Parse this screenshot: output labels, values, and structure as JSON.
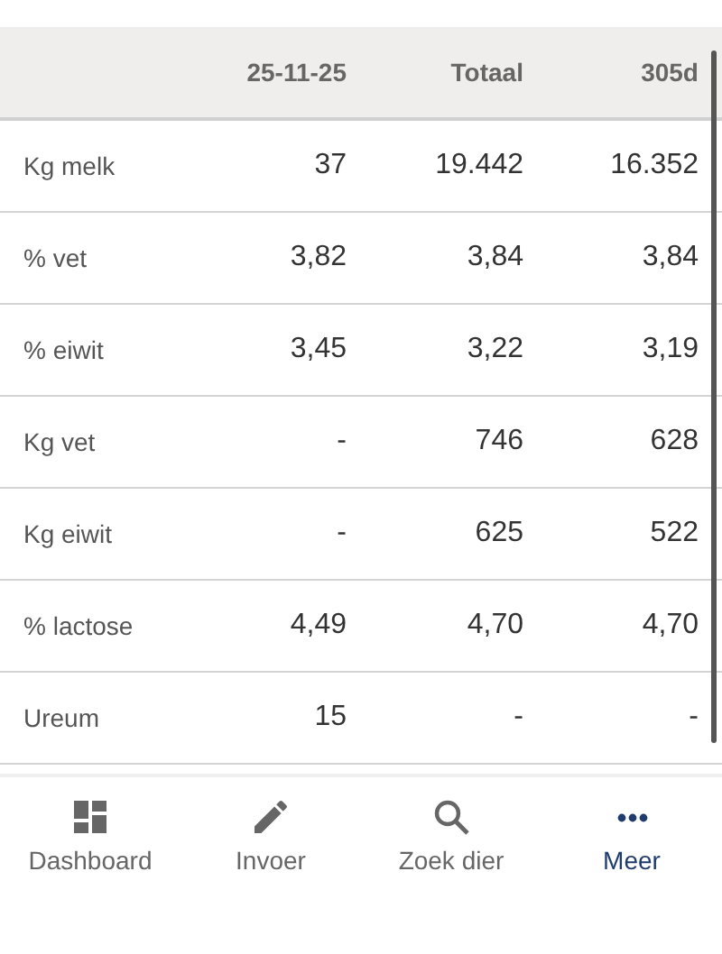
{
  "table": {
    "columns": [
      "",
      "25-11-25",
      "Totaal",
      "305d"
    ],
    "rows": [
      {
        "label": "Kg melk",
        "values": [
          "37",
          "19.442",
          "16.352"
        ]
      },
      {
        "label": "% vet",
        "values": [
          "3,82",
          "3,84",
          "3,84"
        ]
      },
      {
        "label": "% eiwit",
        "values": [
          "3,45",
          "3,22",
          "3,19"
        ]
      },
      {
        "label": "Kg vet",
        "values": [
          "-",
          "746",
          "628"
        ]
      },
      {
        "label": "Kg eiwit",
        "values": [
          "-",
          "625",
          "522"
        ]
      },
      {
        "label": "% lactose",
        "values": [
          "4,49",
          "4,70",
          "4,70"
        ]
      },
      {
        "label": "Ureum",
        "values": [
          "15",
          "-",
          "-"
        ]
      }
    ]
  },
  "bottom_nav": [
    {
      "label": "Dashboard",
      "kind": "dashboard",
      "selected": false
    },
    {
      "label": "Invoer",
      "kind": "pencil",
      "selected": false
    },
    {
      "label": "Zoek dier",
      "kind": "search",
      "selected": false
    },
    {
      "label": "Meer",
      "kind": "more",
      "selected": true
    }
  ]
}
